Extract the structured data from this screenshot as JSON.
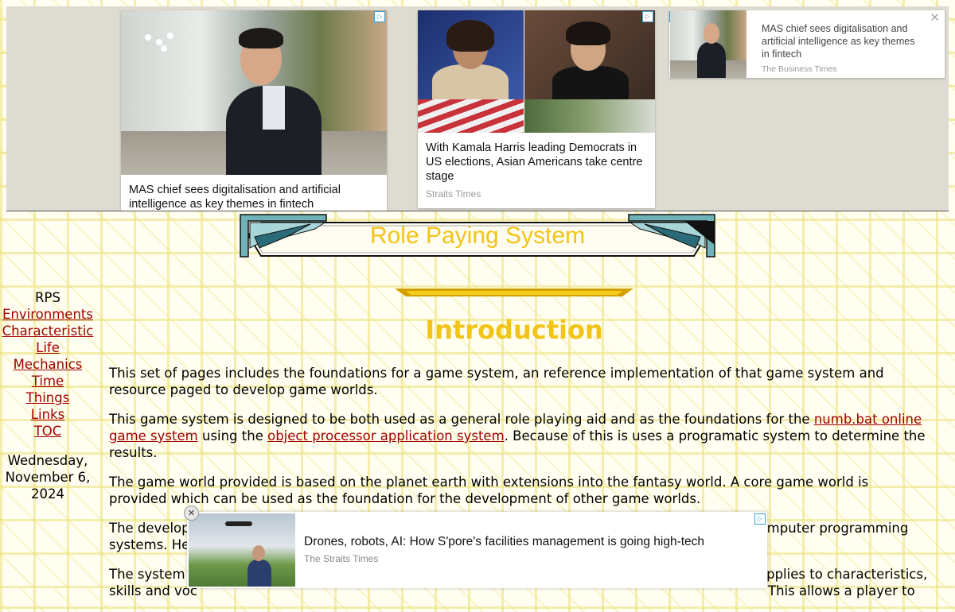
{
  "ads": {
    "card1": {
      "title": "MAS chief sees digitalisation and artificial intelligence as key themes in fintech"
    },
    "card2": {
      "title": "With Kamala Harris leading Democrats in US elections, Asian Americans take centre stage",
      "source": "Straits Times"
    },
    "card3": {
      "title": "MAS chief sees digitalisation and artificial intelligence as key themes in fintech",
      "source": "The Business Times"
    },
    "bottom": {
      "title": "Drones, robots, AI: How S'pore's facilities management is going high-tech",
      "source": "The Straits Times"
    }
  },
  "banner": {
    "title": "Role Paying System"
  },
  "sidebar": {
    "heading": "RPS",
    "links": [
      "Environments",
      "Characteristic",
      "Life",
      "Mechanics",
      "Time",
      "Things",
      "Links",
      "TOC"
    ],
    "date_line1": "Wednesday,",
    "date_line2": "November 6,",
    "date_line3": "2024"
  },
  "main": {
    "heading": "Introduction",
    "p1": "This set of pages includes the foundations for a game system, an reference implementation of that game system and resource paged to develop game worlds.",
    "p2_start": "This game system is designed to be both used as a general role playing aid and as the foundations for the ",
    "p2_link1": "numb.bat online game system",
    "p2_mid": " using the ",
    "p2_link2": "object processor application system",
    "p2_end": ". Because of this is uses a programatic system to determine the results.",
    "p3": "The game world provided is based on the planet earth with extensions into the fantasy world. A core game world is provided which can be used as the foundation for the development of other game worlds.",
    "p4": "The development of this system uses modelling techniques from maths, role playing games, and computer programming systems. Hence there w",
    "p5_a": "The system is",
    "p5_b": "applies to characteristics,",
    "p5_c": "skills and voc",
    "p5_d": "This allows a player to"
  },
  "colors": {
    "title_yellow": "#f2c418",
    "link": "#a00000"
  }
}
